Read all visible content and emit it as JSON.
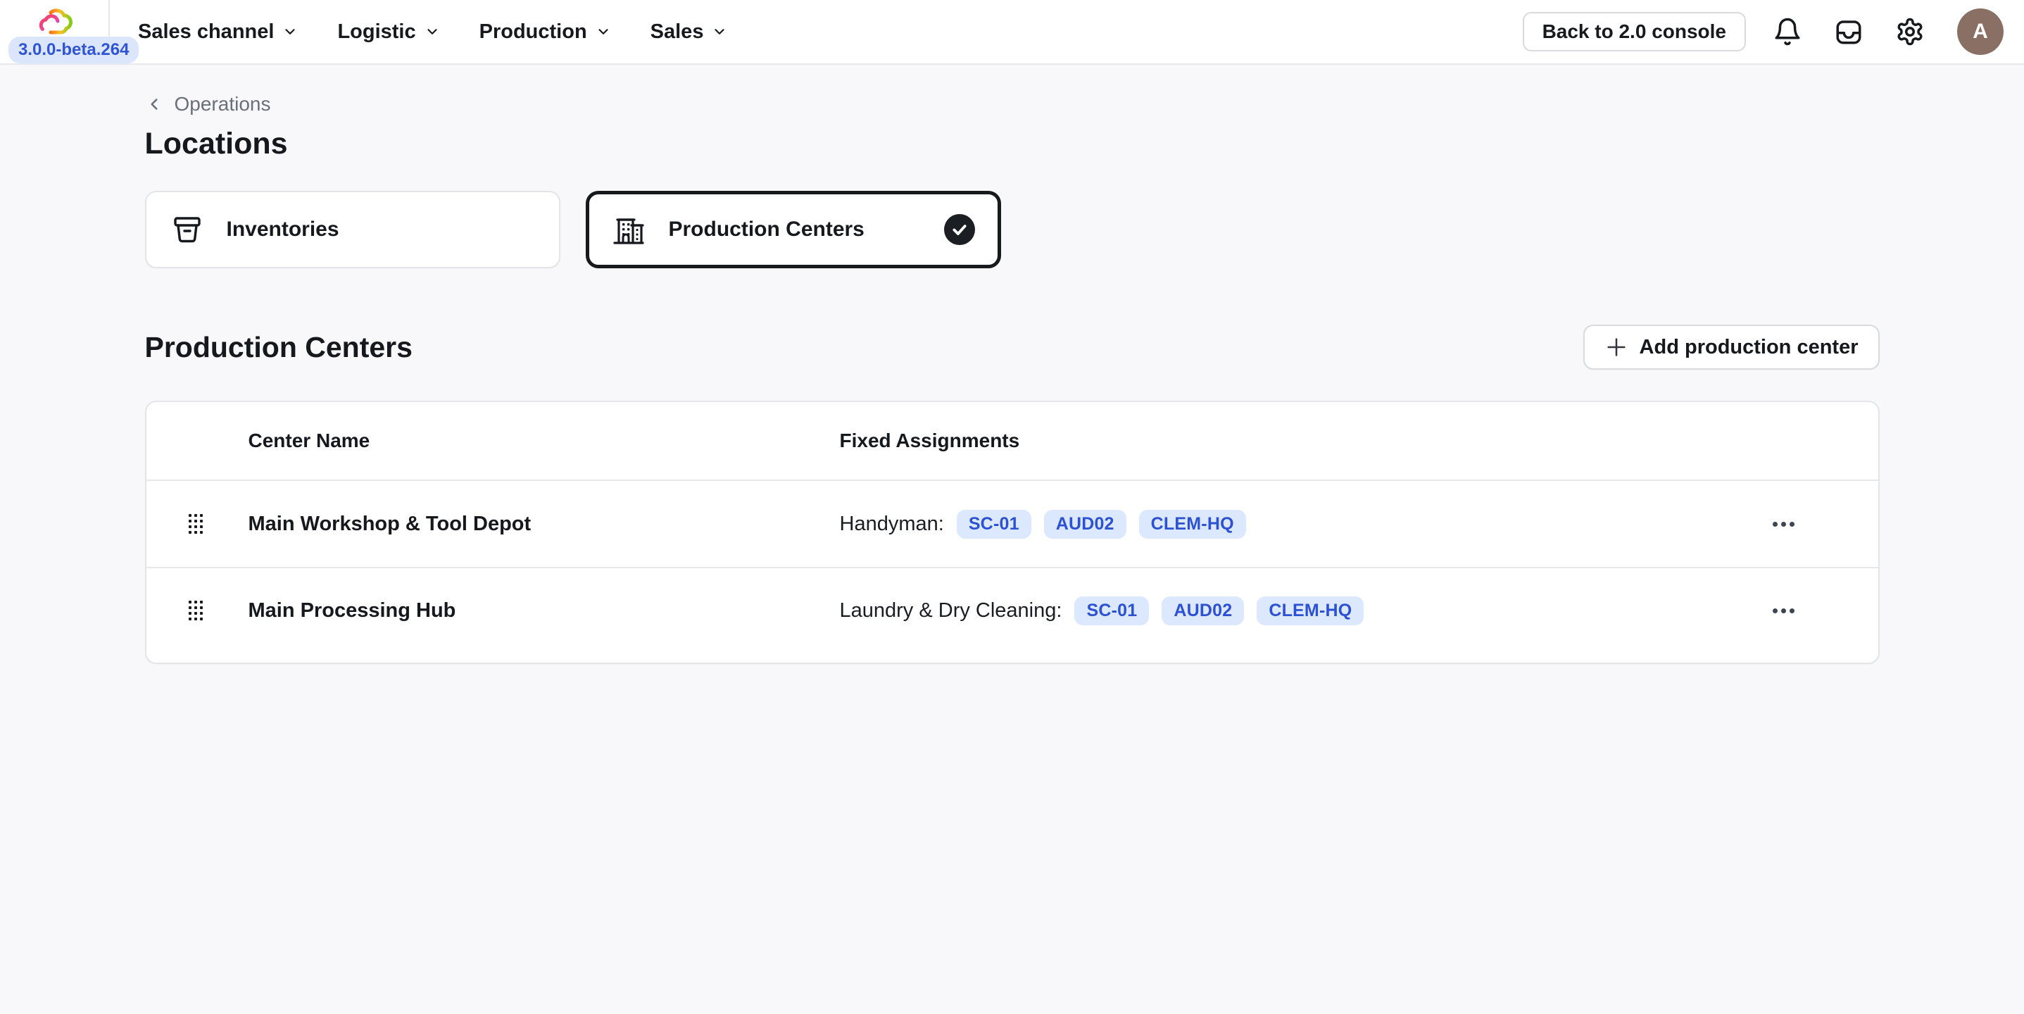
{
  "app": {
    "version_badge": "3.0.0-beta.264"
  },
  "header": {
    "nav_items": [
      {
        "label": "Sales channel"
      },
      {
        "label": "Logistic"
      },
      {
        "label": "Production"
      },
      {
        "label": "Sales"
      }
    ],
    "back_button_label": "Back to 2.0 console",
    "avatar_initial": "A"
  },
  "breadcrumb": {
    "label": "Operations"
  },
  "page": {
    "title": "Locations"
  },
  "location_tabs": {
    "inventories": {
      "label": "Inventories",
      "selected": "false"
    },
    "production_centers": {
      "label": "Production Centers",
      "selected": "true"
    }
  },
  "section": {
    "title": "Production Centers",
    "add_button_label": "Add production center"
  },
  "table": {
    "columns": {
      "name": "Center Name",
      "assignments": "Fixed Assignments"
    },
    "rows": [
      {
        "name": "Main Workshop & Tool Depot",
        "assignment_label": "Handyman:",
        "badges": [
          "SC-01",
          "AUD02",
          "CLEM-HQ"
        ]
      },
      {
        "name": "Main Processing Hub",
        "assignment_label": "Laundry & Dry Cleaning:",
        "badges": [
          "SC-01",
          "AUD02",
          "CLEM-HQ"
        ]
      }
    ]
  },
  "colors": {
    "badge_bg": "#dce8fd",
    "badge_text": "#2c52d3",
    "accent_blue": "#2f55d4",
    "avatar_bg": "#8a7064",
    "selected_border": "#17191d",
    "page_bg": "#f8f8fa"
  }
}
